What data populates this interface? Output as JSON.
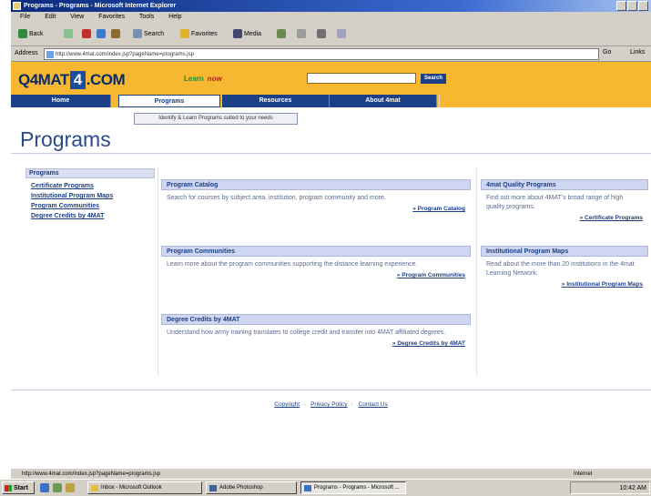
{
  "window": {
    "title": "Programs - Programs - Microsoft Internet Explorer"
  },
  "menubar": {
    "items": [
      "File",
      "Edit",
      "View",
      "Favorites",
      "Tools",
      "Help"
    ]
  },
  "toolbar": {
    "back_label": "Back",
    "search_label": "Search",
    "favorites_label": "Favorites",
    "media_label": "Media"
  },
  "addressbar": {
    "label": "Address",
    "url": "http://www.4mat.com/index.jsp?pageName=programs.jsp",
    "go_label": "Go",
    "links_label": "Links"
  },
  "site": {
    "logo_a": "Q4MAT",
    "logo_box": "4",
    "logo_b": ".COM",
    "tagline_a": "Learn",
    "tagline_b": "now"
  },
  "search": {
    "placeholder": "",
    "button_label": "Search"
  },
  "nav": {
    "tabs": [
      {
        "label": "Home"
      },
      {
        "label": "Programs"
      },
      {
        "label": "Resources"
      },
      {
        "label": "About 4mat"
      }
    ]
  },
  "subtip": "Identify & Learn Programs suited to your needs",
  "page": {
    "title": "Programs"
  },
  "sidebar": {
    "heading": "Programs",
    "links": [
      "Certificate Programs",
      "Institutional Program Maps",
      "Program Communities",
      "Degree Credits by 4MAT"
    ]
  },
  "cards": {
    "catalog": {
      "title": "Program Catalog",
      "body": "Search for courses by subject area, institution, program community and more.",
      "more": "» Program Catalog"
    },
    "communities": {
      "title": "Program Communities",
      "body": "Learn more about the program communities supporting the distance learning experience.",
      "more": "» Program Communities"
    },
    "degree": {
      "title": "Degree Credits by 4MAT",
      "body": "Understand how army training translates to college credit and transfer into 4MAT affiliated degrees.",
      "more": "» Degree Credits by 4MAT"
    },
    "quality": {
      "title": "4mat Quality Programs",
      "body": "Find out more about 4MAT's broad range of high quality programs.",
      "more": "» Certificate Programs"
    },
    "institutions": {
      "title": "Institutional Program Maps",
      "body": "Read about the more than 20 institutions in the 4mat Learning Network.",
      "more": "» Institutional Program Maps"
    }
  },
  "footer": {
    "links": [
      "Copyright",
      "Privacy Policy",
      "Contact Us"
    ]
  },
  "statusbar": {
    "text": "http://www.4mat.com/index.jsp?pageName=programs.jsp",
    "zone": "Internet"
  },
  "taskbar": {
    "start_label": "Start",
    "tasks": [
      "Inbox - Microsoft Outlook",
      "Adobe Photoshop",
      "Programs - Programs - Microsoft ..."
    ],
    "clock": "10:42 AM"
  }
}
